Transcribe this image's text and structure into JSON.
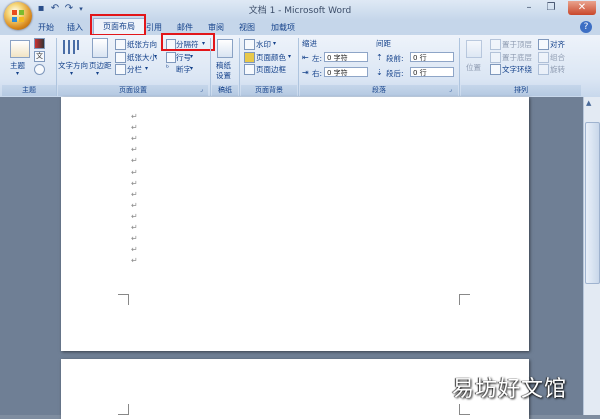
{
  "window": {
    "title": "文档 1 - Microsoft Word"
  },
  "tabs": [
    {
      "label": "开始"
    },
    {
      "label": "插入"
    },
    {
      "label": "页面布局"
    },
    {
      "label": "引用"
    },
    {
      "label": "邮件"
    },
    {
      "label": "审阅"
    },
    {
      "label": "视图"
    },
    {
      "label": "加载项"
    }
  ],
  "help_glyph": "?",
  "groups": {
    "theme": {
      "label": "主题",
      "theme_btn": "主题"
    },
    "page_setup": {
      "label": "页面设置",
      "text_direction": "文字方向",
      "margins": "页边距",
      "orientation": "纸张方向",
      "size": "纸张大小",
      "columns": "分栏",
      "breaks": "分隔符",
      "line_numbers": "行号",
      "hyphenation": "断字"
    },
    "draft": {
      "label": "稿纸",
      "btn": "稿纸",
      "btn2": "设置"
    },
    "page_background": {
      "label": "页面背景",
      "watermark": "水印",
      "page_color": "页面颜色",
      "page_border": "页面边框"
    },
    "paragraph": {
      "label": "段落",
      "indent_title": "缩进",
      "spacing_title": "间距",
      "left_label": "左:",
      "left_value": "0 字符",
      "right_label": "右:",
      "right_value": "0 字符",
      "before_label": "段前:",
      "before_value": "0 行",
      "after_label": "段后:",
      "after_value": "0 行"
    },
    "arrange": {
      "label": "排列",
      "position": "位置",
      "bring_front": "置于顶层",
      "send_back": "置于底层",
      "text_wrap": "文字环绕",
      "align": "对齐",
      "group": "组合",
      "rotate": "旋转"
    }
  },
  "document": {
    "paragraph_mark": "↵",
    "paragraph_count": 14
  },
  "watermark_text": "易坊好文馆",
  "colors": {
    "highlight": "#e2161a",
    "ribbon": "#dbe6f4",
    "background": "#6f7f95"
  }
}
